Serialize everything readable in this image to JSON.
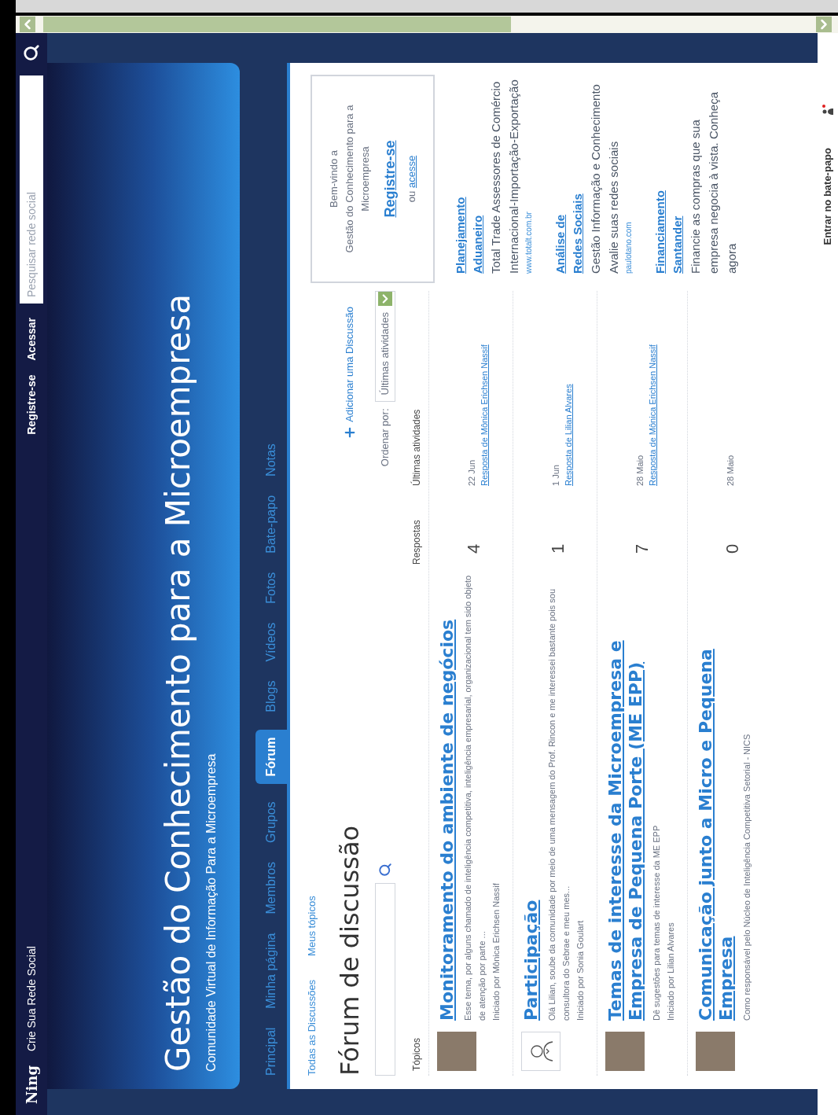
{
  "top_bar": {
    "logo": "Ning",
    "tagline": "Crie Sua Rede Social",
    "links": [
      "Registre-se",
      "Acessar"
    ],
    "search": {
      "placeholder": "Pesquisar rede social"
    }
  },
  "header": {
    "title": "Gestão do Conhecimento para a Microempresa",
    "subtitle": "Comunidade Virtual de Informação Para a Microempresa"
  },
  "nav": [
    {
      "label": "Principal",
      "selected": false
    },
    {
      "label": "Minha página",
      "selected": false
    },
    {
      "label": "Membros",
      "selected": false
    },
    {
      "label": "Grupos",
      "selected": false
    },
    {
      "label": "Fórum",
      "selected": true
    },
    {
      "label": "Blogs",
      "selected": false
    },
    {
      "label": "Vídeos",
      "selected": false
    },
    {
      "label": "Fotos",
      "selected": false
    },
    {
      "label": "Bate-papo",
      "selected": false
    },
    {
      "label": "Notas",
      "selected": false
    }
  ],
  "forum": {
    "filters": [
      "Todas as Discussões",
      "Meus tópicos"
    ],
    "title": "Fórum de discussão",
    "add_link": "Adicionar uma Discussão",
    "sort": {
      "label": "Ordenar por:",
      "value": "Últimas atividades"
    },
    "columns": [
      "Tópicos",
      "Respostas",
      "Últimas atividades"
    ],
    "topics": [
      {
        "kind": "photo",
        "title": "Monitoramento do ambiente de negócios",
        "excerpt": "Esse tema, por alguns chamado de inteligência competitiva, inteligência empresarial, organizacional tem sido objeto de atenção por parte ...",
        "author": "Iniciado por Mônica Erichsen Nassif",
        "replies": "4",
        "date": "22 Jun",
        "reply_link": "Resposta de Mônica Erichsen Nassif"
      },
      {
        "kind": "silhouette",
        "title": "Participação",
        "excerpt": "Olá Lilian, soube da comunidade por meio de uma mensagem do Prof. Rincon e me interessei bastante pois sou consultora do Sebrae e meu mes...",
        "author": "Iniciado por Sonia Goulart",
        "replies": "1",
        "date": "1 Jun",
        "reply_link": "Resposta de Lilian Alvares"
      },
      {
        "kind": "photo",
        "title": "Temas de interesse da Microempresa e Empresa de Pequena Porte (ME EPP)",
        "excerpt": "Dê sugestões para temas de interesse da ME EPP",
        "author": "Iniciado por Lilian Alvares",
        "replies": "7",
        "date": "28 Maio",
        "reply_link": "Resposta de Mônica Erichsen Nassif"
      },
      {
        "kind": "photo",
        "title": "Comunicação junto a Micro e Pequena Empresa",
        "excerpt": "Como responsável pelo Núcleo de Inteligência Competitiva Setorial - NICS",
        "replies": "0",
        "date": "28 Maio"
      }
    ]
  },
  "sidebar": {
    "welcome": {
      "greeting": "Bem-vindo a",
      "site": "Gestão do Conhecimento para a Microempresa",
      "register": "Registre-se",
      "alt_prefix": "ou",
      "alt_link": "acesse"
    },
    "ads": [
      {
        "title": "Planejamento Aduaneiro",
        "text": "Total Trade Assessores de Comércio Internacional-Importação-Exportação",
        "url": "www.totalt.com.br"
      },
      {
        "title": "Análise de Redes Sociais",
        "text": "Gestão Informação e Conhecimento Avalie suas redes sociais",
        "url": "paulotano.com"
      },
      {
        "title": "Financiamento Santander",
        "text": "Financie as compras que sua empresa negocia à vista. Conheça agora"
      }
    ]
  },
  "chat_bar": {
    "label": "Entrar no bate-papo"
  }
}
